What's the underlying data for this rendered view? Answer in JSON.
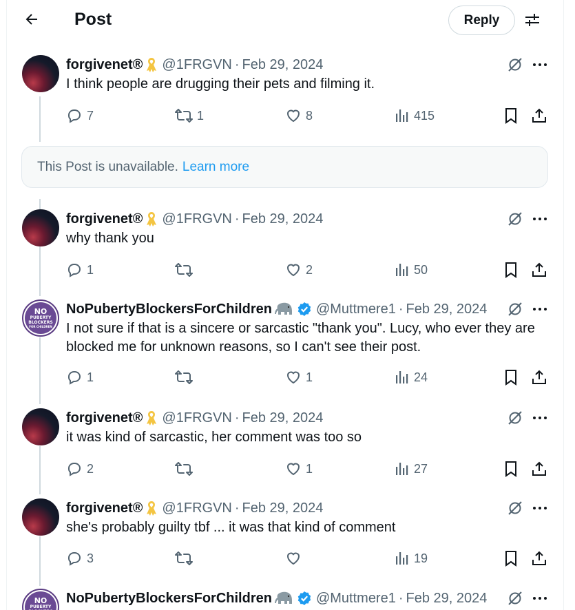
{
  "header": {
    "title": "Post",
    "reply_label": "Reply"
  },
  "unavailable": {
    "text": "This Post is unavailable.",
    "link": "Learn more"
  },
  "posts": [
    {
      "name": "forgivenet®",
      "handle": "@1FRGVN",
      "date": "Feb 29, 2024",
      "text": "I think people are drugging their pets and filming it.",
      "replies": "7",
      "reposts": "1",
      "likes": "8",
      "views": "415"
    },
    {
      "name": "forgivenet®",
      "handle": "@1FRGVN",
      "date": "Feb 29, 2024",
      "text": "why thank you",
      "replies": "1",
      "reposts": "",
      "likes": "2",
      "views": "50"
    },
    {
      "name": "NoPubertyBlockersForChildren",
      "handle": "@Muttmere1",
      "date": "Feb 29, 2024",
      "text": "I not sure if that is a sincere or sarcastic \"thank you\". Lucy, who ever they are blocked me for unknown reasons, so I can't see their post.",
      "replies": "1",
      "reposts": "",
      "likes": "1",
      "views": "24"
    },
    {
      "name": "forgivenet®",
      "handle": "@1FRGVN",
      "date": "Feb 29, 2024",
      "text": "it was kind of sarcastic, her comment was too so",
      "replies": "2",
      "reposts": "",
      "likes": "1",
      "views": "27"
    },
    {
      "name": "forgivenet®",
      "handle": "@1FRGVN",
      "date": "Feb 29, 2024",
      "text": "she's probably guilty tbf ... it was that kind of comment",
      "replies": "3",
      "reposts": "",
      "likes": "",
      "views": "19"
    },
    {
      "name": "NoPubertyBlockersForChildren",
      "handle": "@Muttmere1",
      "date": "Feb 29, 2024",
      "text": "",
      "replies": "",
      "reposts": "",
      "likes": "",
      "views": ""
    }
  ],
  "avatar_logo": {
    "line1": "NO",
    "line2": "PUBERTY",
    "line3": "BLOCKERS",
    "line4": "FOR CHILDREN"
  },
  "colors": {
    "text": "#0f1419",
    "secondary": "#536471",
    "link": "#1d9bf0",
    "verified": "#1d9bf0",
    "ribbon": "#f4c542",
    "border": "#cfd9de"
  }
}
